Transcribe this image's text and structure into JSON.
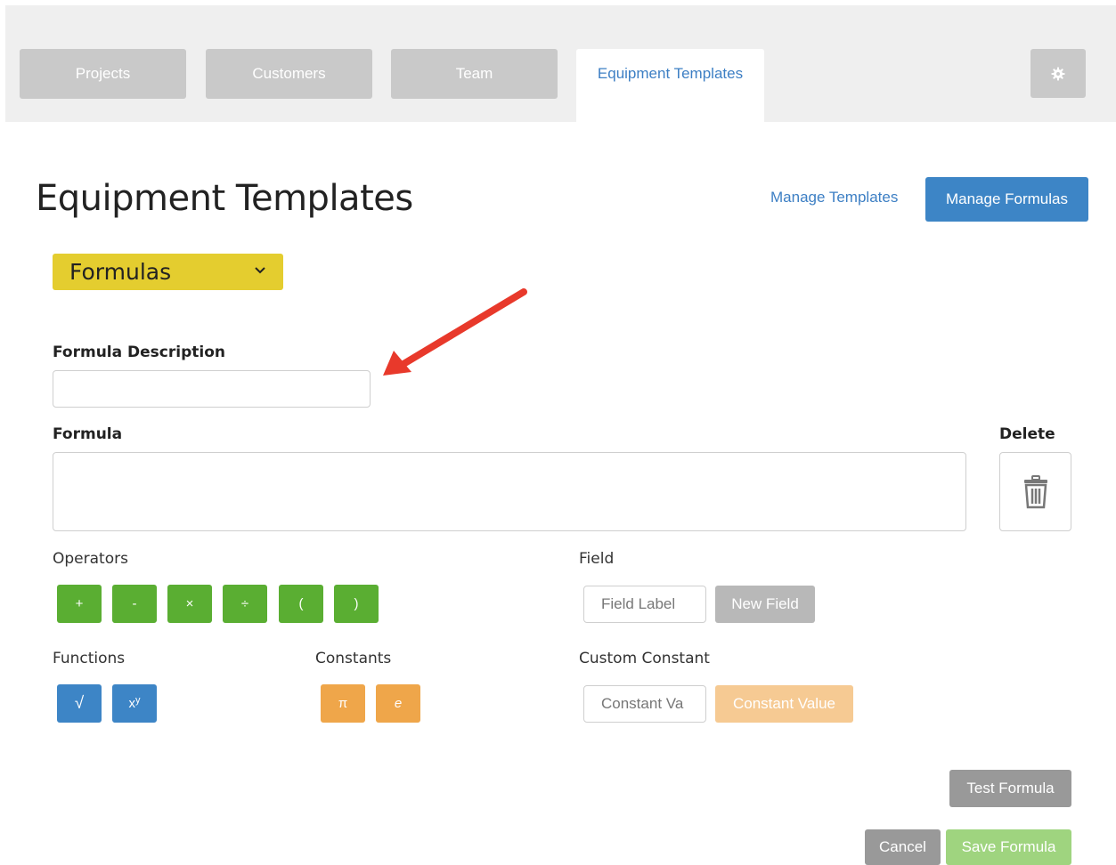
{
  "nav": {
    "tabs": [
      {
        "label": "Projects"
      },
      {
        "label": "Customers"
      },
      {
        "label": "Team"
      },
      {
        "label": "Equipment Templates"
      }
    ],
    "active_tab": "Equipment Templates"
  },
  "header": {
    "title": "Equipment Templates",
    "manage_templates": "Manage Templates",
    "manage_formulas": "Manage Formulas"
  },
  "type_select": {
    "selected": "Formulas"
  },
  "form": {
    "description_label": "Formula Description",
    "description_value": "",
    "formula_label": "Formula",
    "formula_value": "",
    "delete_label": "Delete"
  },
  "operators": {
    "label": "Operators",
    "items": [
      "+",
      "-",
      "×",
      "÷",
      "(",
      ")"
    ]
  },
  "field": {
    "label": "Field",
    "placeholder": "Field Label",
    "new_field": "New Field"
  },
  "functions": {
    "label": "Functions",
    "sqrt": "√",
    "power_base": "x",
    "power_exp": "y"
  },
  "constants": {
    "label": "Constants",
    "pi": "π",
    "e": "e"
  },
  "custom_constant": {
    "label": "Custom Constant",
    "placeholder": "Constant Va",
    "button": "Constant Value"
  },
  "actions": {
    "test": "Test Formula",
    "cancel": "Cancel",
    "save": "Save Formula"
  },
  "colors": {
    "accent_blue": "#3d85c6",
    "operator_green": "#5aae32",
    "constant_orange": "#efa64a",
    "select_yellow": "#e4cd2f",
    "annotation_red": "#e8392b"
  }
}
